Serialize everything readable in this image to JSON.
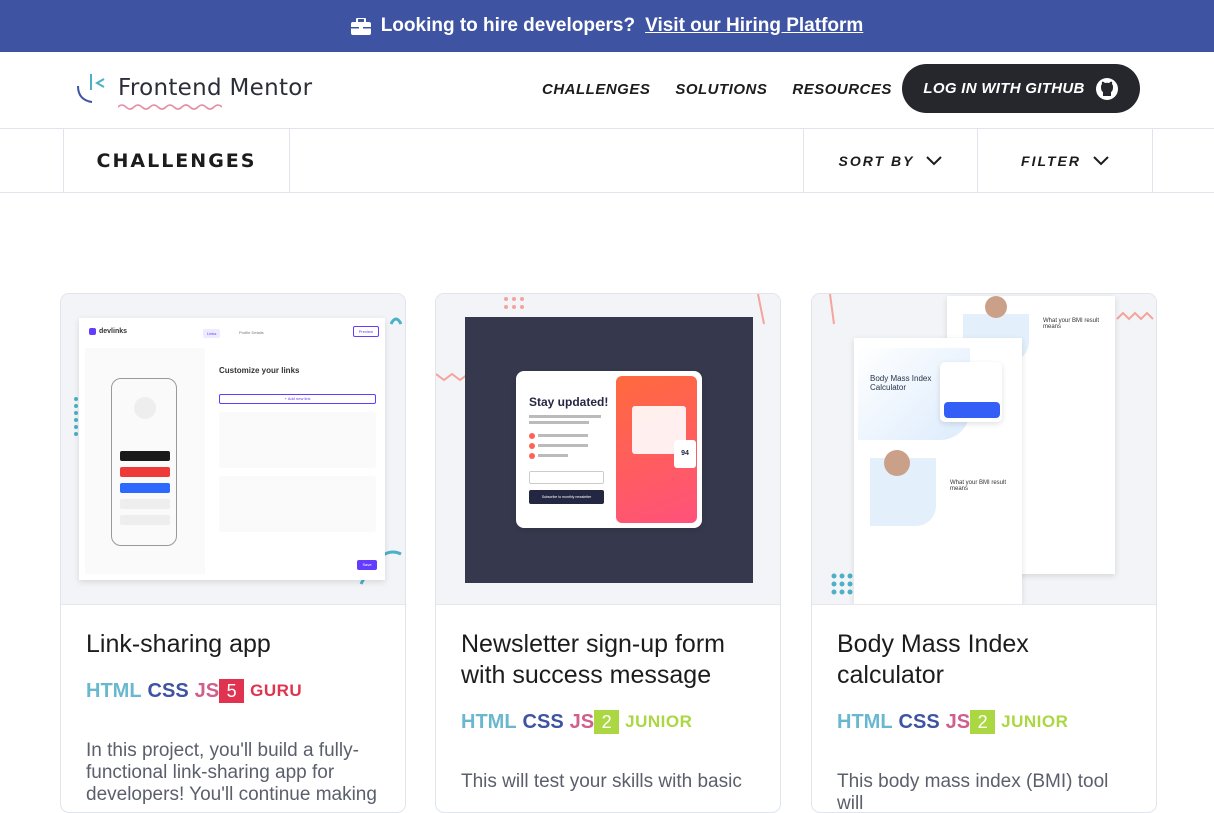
{
  "banner": {
    "text": "Looking to hire developers?",
    "link": "Visit our Hiring Platform",
    "icon": "briefcase-icon"
  },
  "header": {
    "logo_text": "Frontend Mentor",
    "nav": [
      "CHALLENGES",
      "SOLUTIONS",
      "RESOURCES"
    ],
    "login_label": "LOG IN WITH GITHUB",
    "login_icon": "github-icon"
  },
  "subbar": {
    "title": "CHALLENGES",
    "sort_label": "SORT BY",
    "filter_label": "FILTER"
  },
  "cards": [
    {
      "title": "Link-sharing app",
      "tags": [
        "HTML",
        "CSS",
        "JS"
      ],
      "level_num": "5",
      "level_word": "GURU",
      "level_color": "#e0334f",
      "description": "In this project, you'll build a fully-functional link-sharing app for developers! You'll continue making",
      "thumb": {
        "logo": "devlinks",
        "tab_links": "Links",
        "tab_profile": "Profile Details",
        "preview": "Preview",
        "heading": "Customize your links",
        "add_link": "+ Add new link",
        "save": "Save"
      }
    },
    {
      "title": "Newsletter sign-up form with success message",
      "tags": [
        "HTML",
        "CSS",
        "JS"
      ],
      "level_num": "2",
      "level_word": "JUNIOR",
      "level_color": "#aad742",
      "description": "This will test your skills with basic",
      "thumb": {
        "heading": "Stay updated!",
        "button": "Subscribe to monthly newsletter",
        "badge": "94"
      }
    },
    {
      "title": "Body Mass Index calculator",
      "tags": [
        "HTML",
        "CSS",
        "JS"
      ],
      "level_num": "2",
      "level_word": "JUNIOR",
      "level_color": "#aad742",
      "description": "This body mass index (BMI) tool will",
      "thumb": {
        "heading": "Body Mass Index Calculator",
        "result_1": "What your BMI result means",
        "result_2": "What your BMI result means"
      }
    }
  ]
}
